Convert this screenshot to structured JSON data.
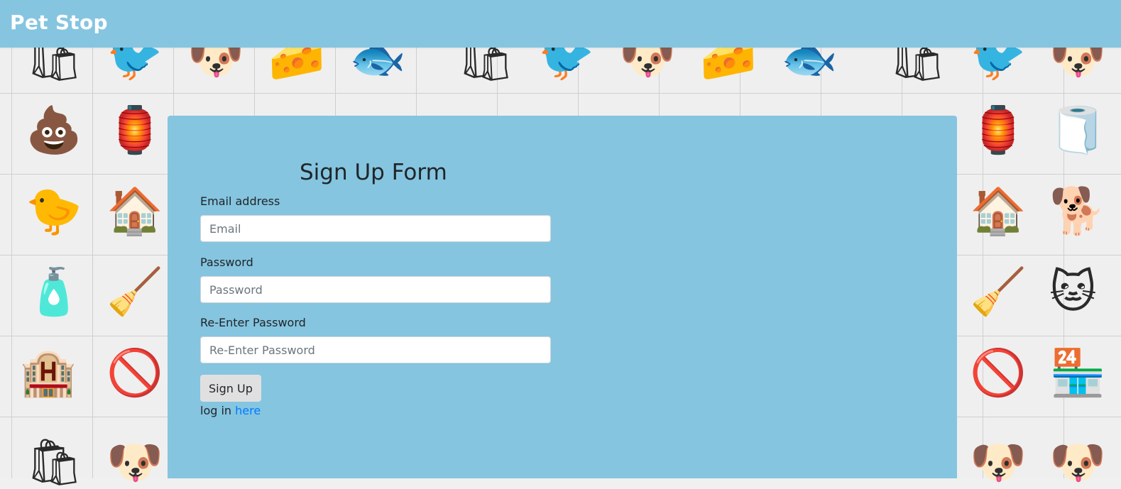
{
  "app": {
    "brand": "Pet Stop"
  },
  "form": {
    "title": "Sign Up Form",
    "email_label": "Email address",
    "email_placeholder": "Email",
    "email_value": "",
    "password_label": "Password",
    "password_placeholder": "Password",
    "password_value": "",
    "reenter_label": "Re-Enter Password",
    "reenter_placeholder": "Re-Enter Password",
    "reenter_value": "",
    "submit_label": "Sign Up",
    "login_prefix": "log in",
    "login_link": "here"
  },
  "colors": {
    "header": "#85c5e0",
    "panel": "#85c5e0",
    "link": "#007bff",
    "button": "#e0e0e0"
  },
  "background": {
    "icons": [
      "dog-food-bag-icon",
      "bird-icon",
      "dog-face-icon",
      "cheese-icon",
      "fish-bone-icon",
      "poop-icon",
      "bird-cage-icon",
      "lint-roller-icon",
      "dog-bowl-icon",
      "pet-bed-icon",
      "chick-icon",
      "dog-house-icon",
      "dog-walking-icon",
      "shampoo-bottle-icon",
      "litter-scoop-icon",
      "cat-food-bag-icon",
      "dog-hotel-sign-icon",
      "no-pets-sign-icon",
      "pet-shop-icon"
    ]
  }
}
